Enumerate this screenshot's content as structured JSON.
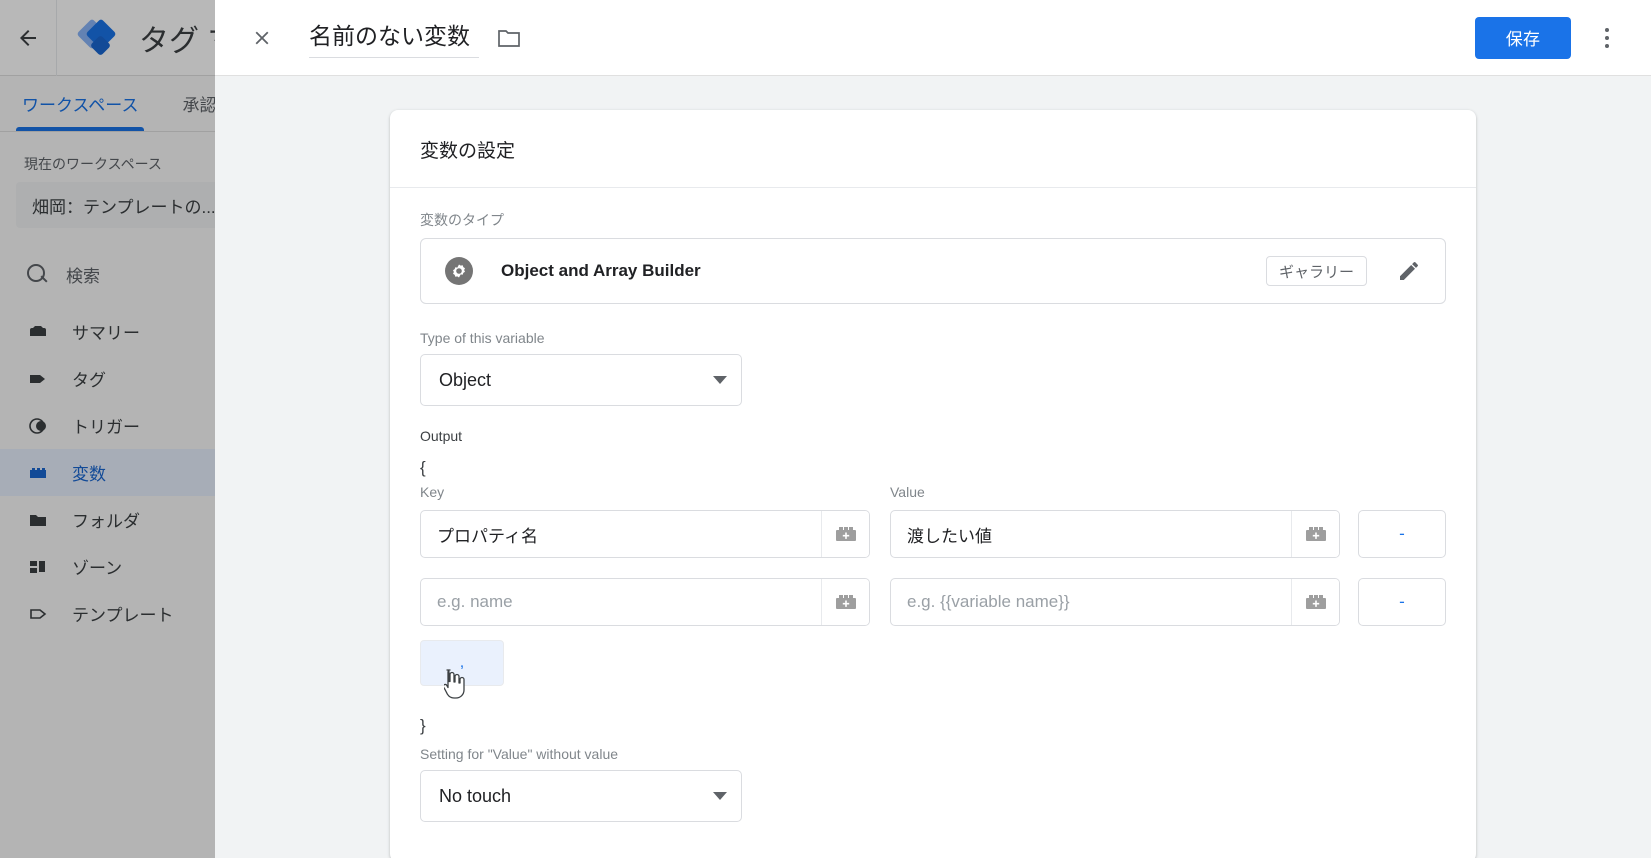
{
  "app": {
    "title": "タグ マネージャー",
    "back_icon": "back-arrow-icon",
    "logo_icon": "gtm-logo-icon"
  },
  "tabs": [
    {
      "label": "ワークスペース",
      "active": true
    },
    {
      "label": "承認",
      "active": false
    }
  ],
  "sidebar": {
    "workspace_label": "現在のワークスペース",
    "workspace_name": "畑岡：テンプレートの...",
    "search_placeholder": "検索",
    "search_icon": "search-icon",
    "items": [
      {
        "label": "サマリー",
        "icon": "summary-icon",
        "active": false
      },
      {
        "label": "タグ",
        "icon": "tag-icon",
        "active": false
      },
      {
        "label": "トリガー",
        "icon": "trigger-icon",
        "active": false
      },
      {
        "label": "変数",
        "icon": "variable-icon",
        "active": true
      },
      {
        "label": "フォルダ",
        "icon": "folder-icon",
        "active": false
      },
      {
        "label": "ゾーン",
        "icon": "zone-icon",
        "active": false
      },
      {
        "label": "テンプレート",
        "icon": "template-icon",
        "active": false
      }
    ]
  },
  "modal": {
    "close_icon": "close-icon",
    "title": "名前のない変数",
    "folder_icon": "folder-icon",
    "save_label": "保存",
    "more_icon": "more-vertical-icon"
  },
  "card": {
    "title": "変数の設定",
    "type_label": "変数のタイプ",
    "type_name": "Object and Array Builder",
    "type_icon": "gear-icon",
    "gallery_label": "ギャラリー",
    "edit_icon": "pencil-icon"
  },
  "form": {
    "type_of_variable_label": "Type of this variable",
    "type_of_variable_value": "Object",
    "output_label": "Output",
    "open_brace": "{",
    "close_brace": "}",
    "key_header": "Key",
    "value_header": "Value",
    "rows": [
      {
        "key_value": "プロパティ名",
        "key_placeholder": "e.g. name",
        "value_value": "渡したい値",
        "value_placeholder": "e.g. {{variable name}}",
        "remove_label": "-",
        "lego_icon": "lego-add-icon"
      },
      {
        "key_value": "",
        "key_placeholder": "e.g. name",
        "value_value": "",
        "value_placeholder": "e.g. {{variable name}}",
        "remove_label": "-",
        "lego_icon": "lego-add-icon"
      }
    ],
    "add_row_label": ",",
    "without_value_label": "Setting for \"Value\" without value",
    "without_value_value": "No touch"
  },
  "colors": {
    "accent": "#1a73e8",
    "accent_light": "#8ab4f8",
    "nav_active_bg": "#e8f0fe",
    "comma_btn_bg": "#eaf1fd",
    "text_primary": "#202124",
    "text_secondary": "#5f6368",
    "text_muted": "#80868b",
    "border": "#dadce0",
    "modal_bg": "#f1f3f4"
  }
}
